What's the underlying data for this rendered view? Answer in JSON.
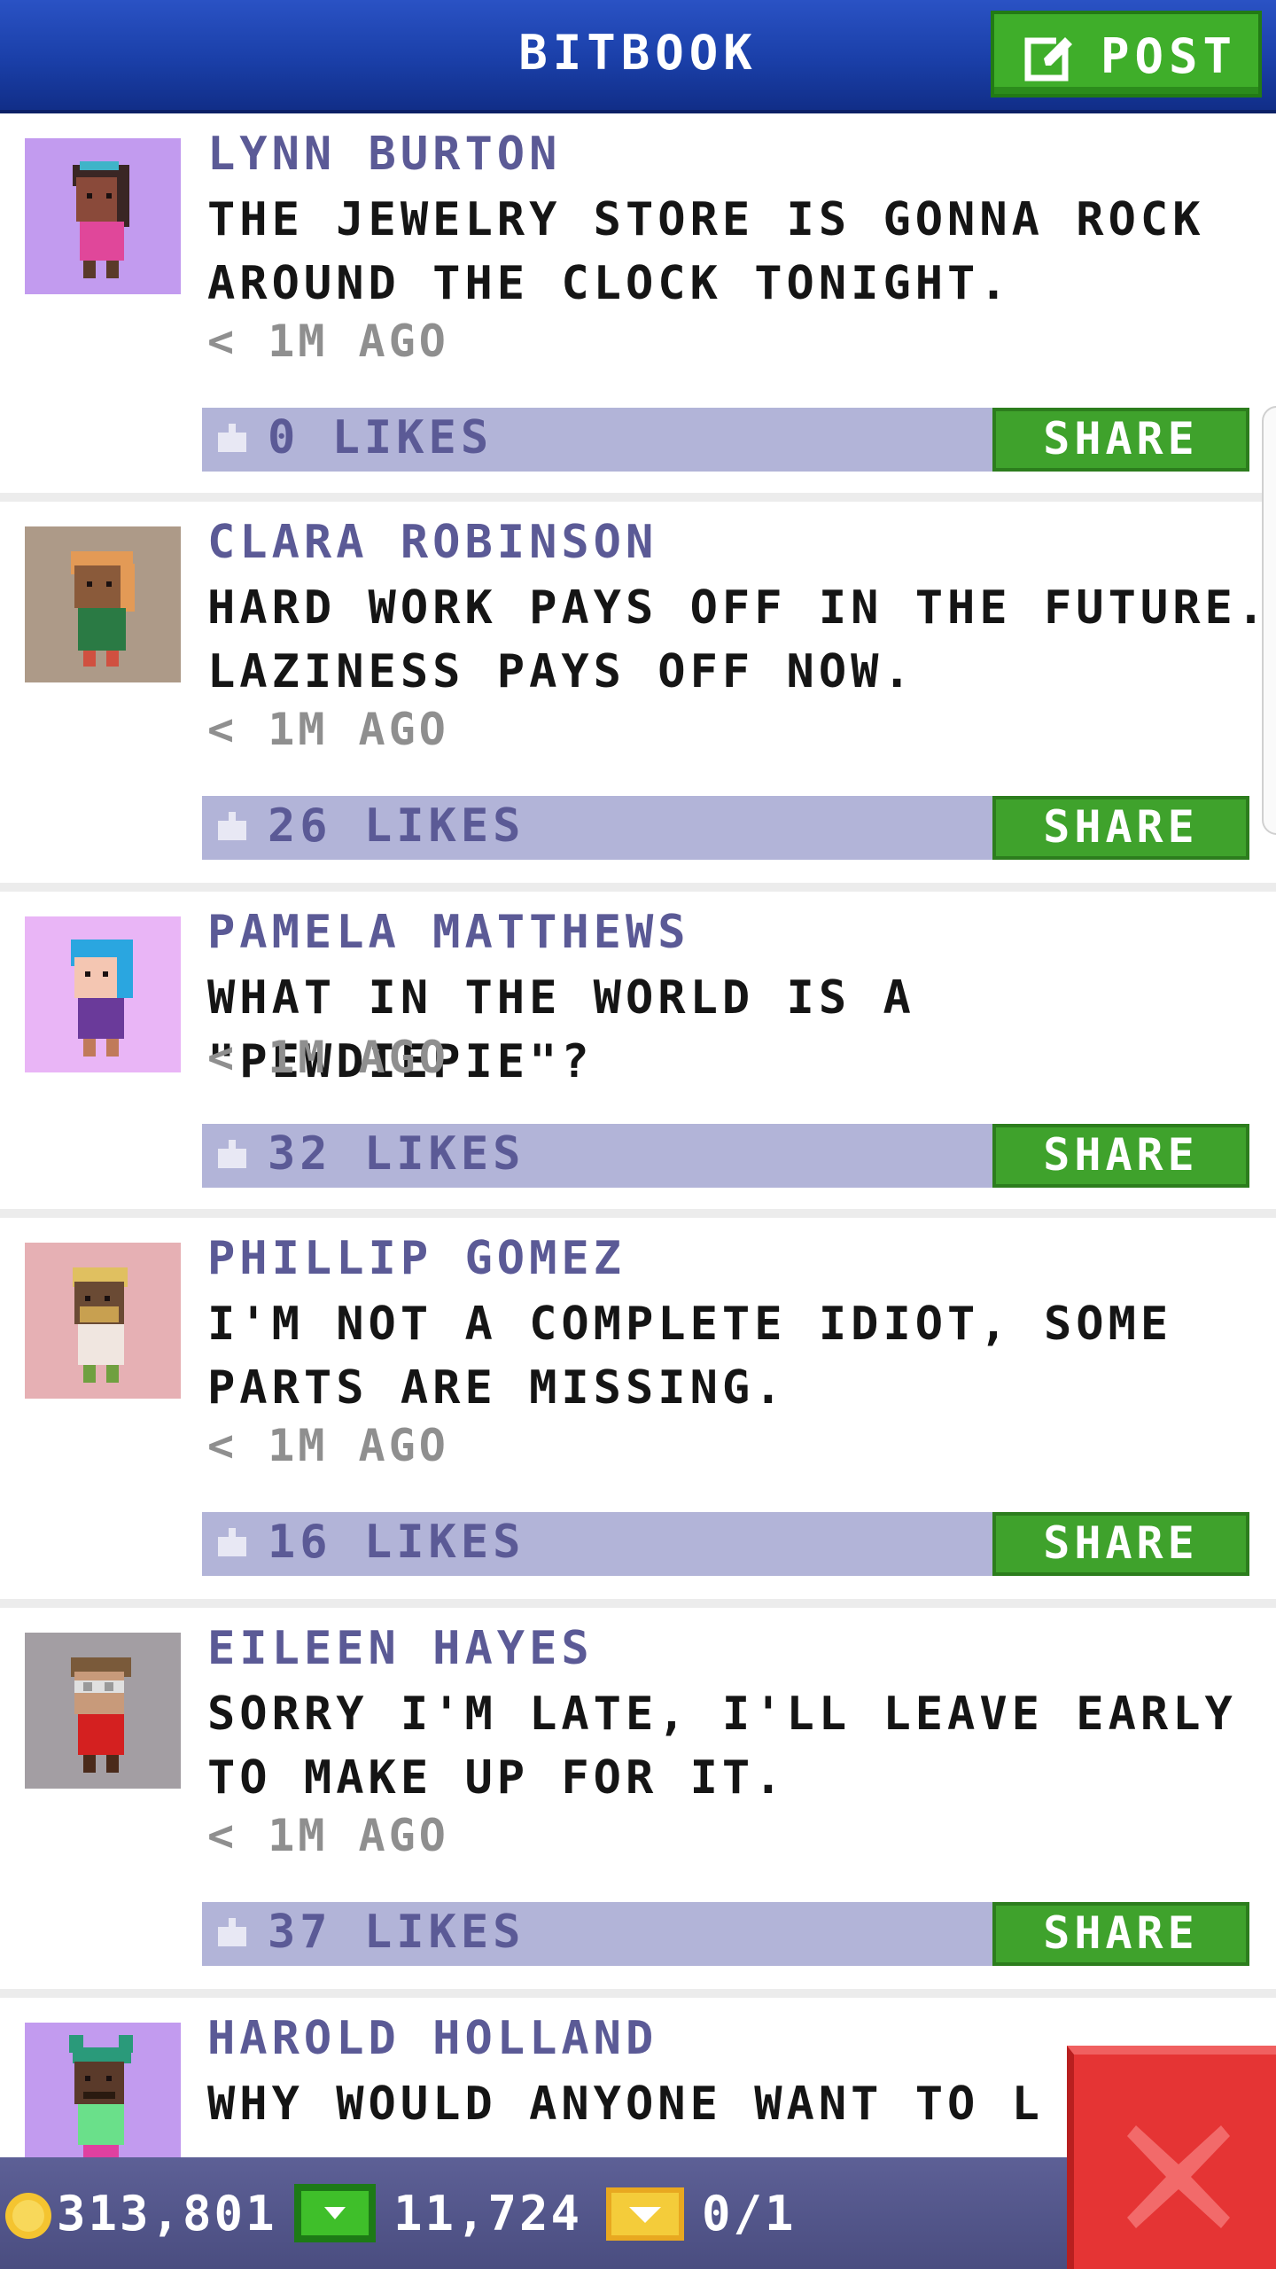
{
  "header": {
    "title": "BITBOOK",
    "post_label": "POST"
  },
  "posts": [
    {
      "author": "LYNN BURTON",
      "message": "THE JEWELRY STORE IS GONNA ROCK AROUND THE CLOCK TONIGHT.",
      "time": "< 1M AGO",
      "likes": "0 LIKES",
      "share": "SHARE",
      "avatar_bg": "#c29bef"
    },
    {
      "author": "CLARA ROBINSON",
      "message": "HARD WORK PAYS OFF IN THE FUTURE. LAZINESS PAYS OFF NOW.",
      "time": "< 1M AGO",
      "likes": "26 LIKES",
      "share": "SHARE",
      "avatar_bg": "#ad9a88"
    },
    {
      "author": "PAMELA MATTHEWS",
      "message": "WHAT IN THE WORLD IS A \"PEWDIEPIE\"?",
      "time": "< 1M AGO",
      "likes": "32 LIKES",
      "share": "SHARE",
      "avatar_bg": "#e9b5f6"
    },
    {
      "author": "PHILLIP GOMEZ",
      "message": "I'M NOT A COMPLETE IDIOT, SOME PARTS ARE MISSING.",
      "time": "< 1M AGO",
      "likes": "16 LIKES",
      "share": "SHARE",
      "avatar_bg": "#e6b0b4"
    },
    {
      "author": "EILEEN HAYES",
      "message": "SORRY I'M LATE, I'LL LEAVE EARLY TO MAKE UP FOR IT.",
      "time": "< 1M AGO",
      "likes": "37 LIKES",
      "share": "SHARE",
      "avatar_bg": "#a39ea3"
    },
    {
      "author": "HAROLD HOLLAND",
      "message": "WHY WOULD ANYONE WANT TO L",
      "avatar_bg": "#c29bef"
    }
  ],
  "status": {
    "coins": "313,801",
    "bux": "11,724",
    "tickets": "0/1"
  },
  "colors": {
    "header": "#1a3fa8",
    "share_green": "#3fa22c",
    "likes_bar": "#b2b4d8",
    "close_red": "#e53434"
  },
  "icons": {
    "post": "compose-icon",
    "like": "thumbs-up-icon",
    "coin": "coin-icon",
    "bux": "bux-icon",
    "ticket": "ticket-icon",
    "close": "close-icon"
  }
}
